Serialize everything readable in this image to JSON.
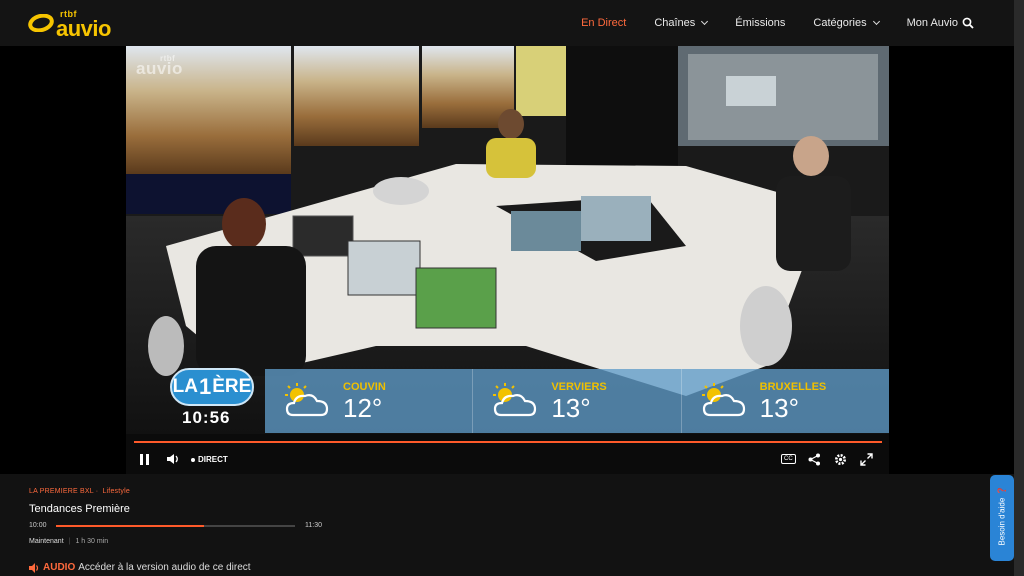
{
  "brand": {
    "small": "rtbf",
    "name": "auvio",
    "color": "#f6c400"
  },
  "nav": {
    "items": [
      {
        "label": "En Direct",
        "active": true,
        "dropdown": false
      },
      {
        "label": "Chaînes",
        "active": false,
        "dropdown": true
      },
      {
        "label": "Émissions",
        "active": false,
        "dropdown": false
      },
      {
        "label": "Catégories",
        "active": false,
        "dropdown": true
      },
      {
        "label": "Mon Auvio",
        "active": false,
        "dropdown": false
      }
    ],
    "search_icon": "search-icon",
    "accent": "#ff6a3d"
  },
  "video": {
    "watermark_small": "rtbf",
    "watermark": "auvio",
    "station_logo": "LA 1ÈRE",
    "station_logo_parts": {
      "a": "LA",
      "b": "1",
      "c": "ÈRE"
    },
    "clock": "10:56",
    "weather": [
      {
        "city": "COUVIN",
        "temp": "12°",
        "icon": "partly-cloudy-icon"
      },
      {
        "city": "VERVIERS",
        "temp": "13°",
        "icon": "partly-cloudy-icon"
      },
      {
        "city": "BRUXELLES",
        "temp": "13°",
        "icon": "partly-cloudy-icon"
      }
    ]
  },
  "player": {
    "live_label": "DIRECT",
    "cc_label": "CC",
    "progress": 1.0,
    "icons": [
      "pause-icon",
      "volume-icon",
      "captions-icon",
      "share-icon",
      "settings-icon",
      "fullscreen-icon"
    ]
  },
  "program": {
    "channel": "LA PREMIERE BXL",
    "separator": "·",
    "category": "Lifestyle",
    "title": "Tendances Première",
    "start": "10:00",
    "end": "11:30",
    "progress": 0.62,
    "now_label": "Maintenant",
    "duration": "1 h 30 min"
  },
  "audio": {
    "label": "AUDIO",
    "text": "Accéder à la version audio de ce direct"
  },
  "help": {
    "label": "Besoin d'aide"
  }
}
